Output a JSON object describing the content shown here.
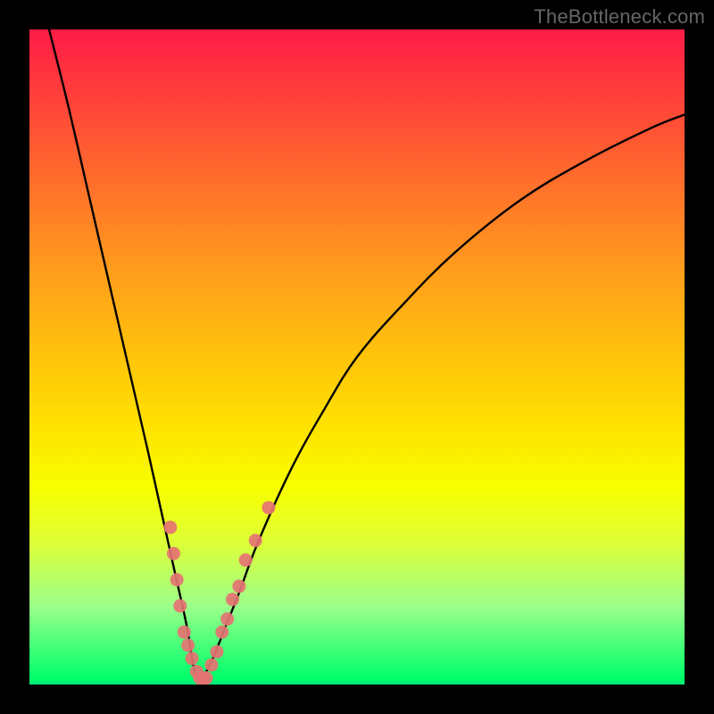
{
  "watermark": "TheBottleneck.com",
  "colors": {
    "frame": "#000000",
    "curve": "#000000",
    "dot_fill": "#e57373",
    "dot_stroke": "#c94f4f"
  },
  "chart_data": {
    "type": "line",
    "title": "",
    "xlabel": "",
    "ylabel": "",
    "xlim": [
      0,
      100
    ],
    "ylim": [
      0,
      100
    ],
    "notes": "V-shaped bottleneck curve on a vertical red→green gradient. Minimum near x≈26 at y≈0. Left branch rises steeply toward top-left; right branch rises more gradually toward upper-right. Pink dots cluster on both branches near the valley floor (roughly y 0–35).",
    "series": [
      {
        "name": "left_branch",
        "x": [
          3,
          6,
          9,
          12,
          15,
          18,
          20,
          22,
          24,
          25,
          26
        ],
        "y": [
          100,
          88,
          75,
          62,
          49,
          36,
          27,
          18,
          9,
          3,
          0
        ]
      },
      {
        "name": "right_branch",
        "x": [
          26,
          28,
          30,
          32,
          35,
          40,
          45,
          50,
          57,
          65,
          75,
          85,
          95,
          100
        ],
        "y": [
          0,
          4,
          9,
          14,
          22,
          33,
          42,
          50,
          58,
          66,
          74,
          80,
          85,
          87
        ]
      }
    ],
    "dots": [
      {
        "x": 21.5,
        "y": 24
      },
      {
        "x": 22.0,
        "y": 20
      },
      {
        "x": 22.5,
        "y": 16
      },
      {
        "x": 23.0,
        "y": 12
      },
      {
        "x": 23.6,
        "y": 8
      },
      {
        "x": 24.2,
        "y": 6
      },
      {
        "x": 24.8,
        "y": 4
      },
      {
        "x": 25.5,
        "y": 2
      },
      {
        "x": 26.0,
        "y": 1
      },
      {
        "x": 26.5,
        "y": 1
      },
      {
        "x": 27.0,
        "y": 1
      },
      {
        "x": 27.8,
        "y": 3
      },
      {
        "x": 28.6,
        "y": 5
      },
      {
        "x": 29.4,
        "y": 8
      },
      {
        "x": 30.2,
        "y": 10
      },
      {
        "x": 31.0,
        "y": 13
      },
      {
        "x": 32.0,
        "y": 15
      },
      {
        "x": 33.0,
        "y": 19
      },
      {
        "x": 34.5,
        "y": 22
      },
      {
        "x": 36.5,
        "y": 27
      }
    ]
  }
}
